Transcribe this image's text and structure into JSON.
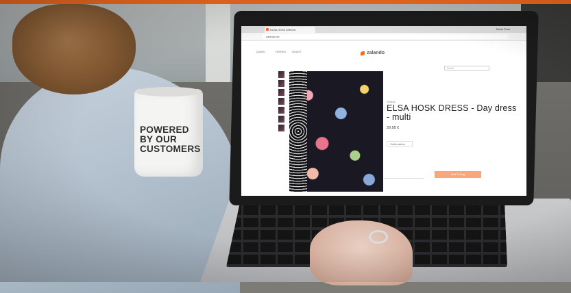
{
  "mug": {
    "line1": "POWERED",
    "line2": "BY OUR",
    "line3": "CUSTOMERS"
  },
  "browser": {
    "tab_title": "ELSA HOSK DRESS",
    "profile": "Marie Pose",
    "url": "zalando.de"
  },
  "site": {
    "logo": "zalando",
    "nav": [
      "DAMEN",
      "HERREN",
      "KINDER"
    ],
    "search_placeholder": "Suche"
  },
  "product": {
    "brand": "Gestuz",
    "title": "ELSA HOSK DRESS - Day dress - multi",
    "price": "29,95 €",
    "size_select": "Größe wählen",
    "add_to_bag": "Add To Bag"
  },
  "colors": {
    "brand_orange": "#f36b20",
    "button_orange": "#f8a77a"
  }
}
